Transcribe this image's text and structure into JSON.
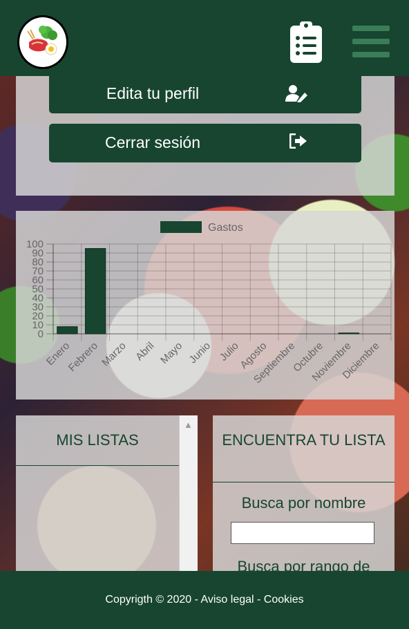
{
  "header": {
    "logo_icon": "food-logo-icon",
    "list_icon": "clipboard-list-icon",
    "menu_icon": "hamburger-menu-icon"
  },
  "profile": {
    "edit_label": "Edita tu perfil",
    "edit_icon": "user-edit-icon",
    "logout_label": "Cerrar sesión",
    "logout_icon": "sign-out-icon"
  },
  "chart_data": {
    "type": "bar",
    "legend": [
      "Gastos"
    ],
    "categories": [
      "Enero",
      "Febrero",
      "Marzo",
      "Abril",
      "Mayo",
      "Junio",
      "Julio",
      "Agosto",
      "Septiembre",
      "Octubre",
      "Noviembre",
      "Diciembre"
    ],
    "series": [
      {
        "name": "Gastos",
        "values": [
          8,
          95,
          0,
          0,
          0,
          0,
          0,
          0,
          0,
          0,
          1,
          0
        ]
      }
    ],
    "yticks": [
      0,
      10,
      20,
      30,
      40,
      50,
      60,
      70,
      80,
      90,
      100
    ],
    "ylim": [
      0,
      100
    ],
    "grid": true,
    "legend_position": "top",
    "color": "#174530"
  },
  "lists": {
    "title": "MIS LISTAS"
  },
  "find": {
    "title": "ENCUENTRA TU LISTA",
    "by_name": "Busca por nombre",
    "name_value": "",
    "by_range": "Busca por rango de"
  },
  "footer": {
    "copyright": "Copyrigth © 2020 - ",
    "legal": "Aviso legal",
    "sep": " - ",
    "cookies": "Cookies"
  }
}
